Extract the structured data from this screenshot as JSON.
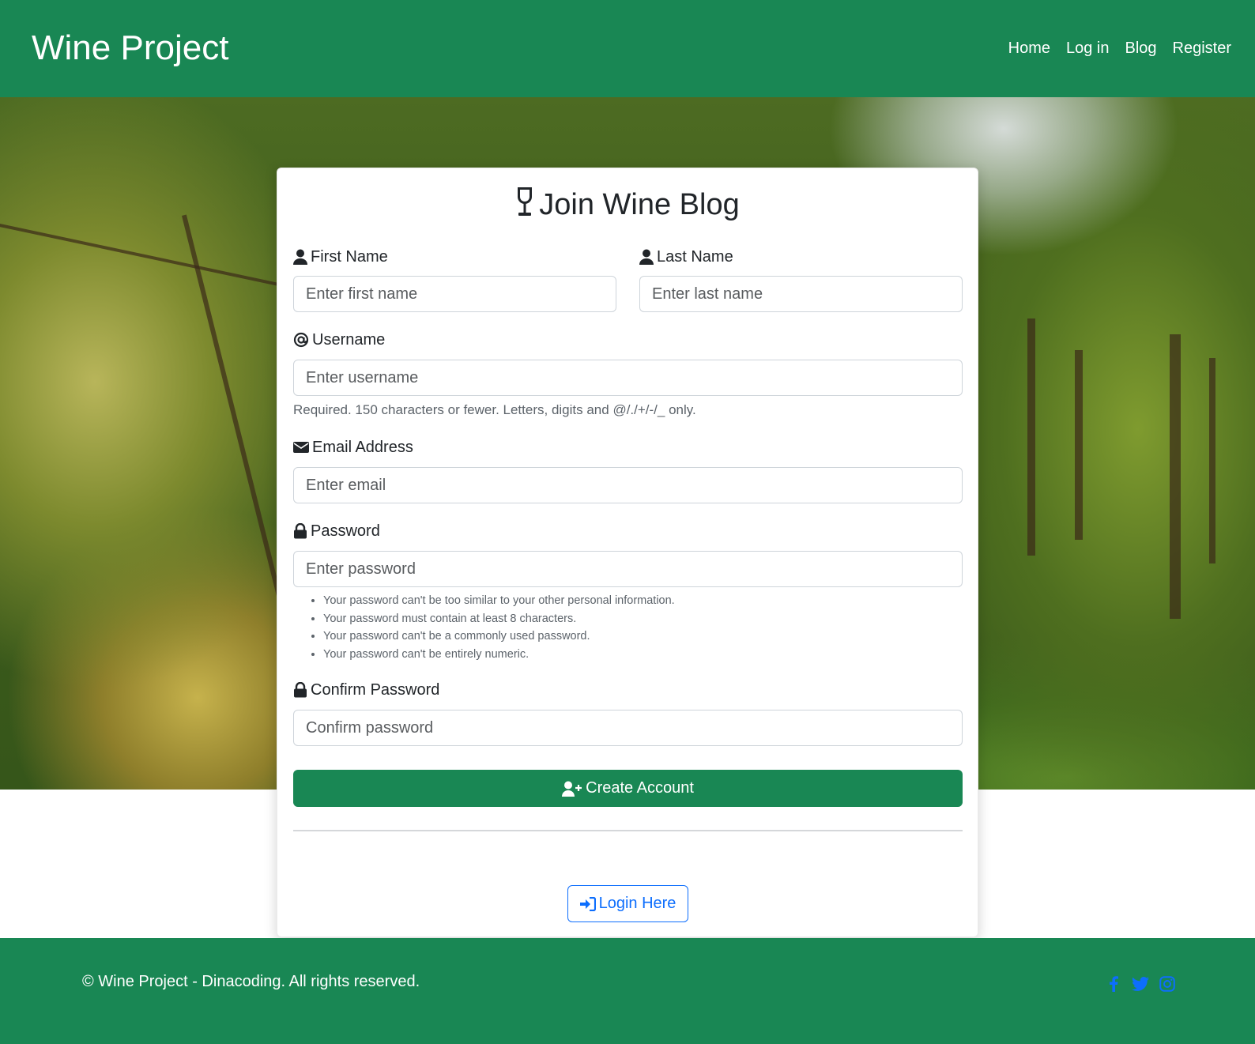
{
  "navbar": {
    "brand": "Wine Project",
    "links": [
      "Home",
      "Log in",
      "Blog",
      "Register"
    ]
  },
  "form": {
    "title": "Join Wine Blog",
    "first_name": {
      "label": "First Name",
      "placeholder": "Enter first name"
    },
    "last_name": {
      "label": "Last Name",
      "placeholder": "Enter last name"
    },
    "username": {
      "label": "Username",
      "placeholder": "Enter username",
      "help": "Required. 150 characters or fewer. Letters, digits and @/./+/-/_ only."
    },
    "email": {
      "label": "Email Address",
      "placeholder": "Enter email"
    },
    "password": {
      "label": "Password",
      "placeholder": "Enter password",
      "rules": [
        "Your password can't be too similar to your other personal information.",
        "Your password must contain at least 8 characters.",
        "Your password can't be a commonly used password.",
        "Your password can't be entirely numeric."
      ]
    },
    "confirm_password": {
      "label": "Confirm Password",
      "placeholder": "Confirm password"
    },
    "create_button": "Create Account",
    "login_button": "Login Here"
  },
  "footer": {
    "copyright": "© Wine Project - Dinacoding. All rights reserved.",
    "social_icons": [
      "facebook-icon",
      "twitter-icon",
      "instagram-icon"
    ]
  },
  "colors": {
    "brand_green": "#198754",
    "link_blue": "#0d6efd"
  }
}
